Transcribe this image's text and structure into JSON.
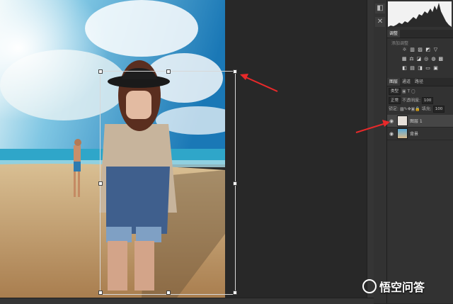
{
  "panels": {
    "adjustments": {
      "tab": "调整",
      "hint": "添加调整",
      "icons": [
        [
          "brightness-icon",
          "levels-icon",
          "curves-icon",
          "exposure-icon",
          "vibrance-icon"
        ],
        [
          "hsl-icon",
          "color-balance-icon",
          "bw-icon",
          "photo-filter-icon",
          "channel-mixer-icon",
          "lookup-icon"
        ],
        [
          "invert-icon",
          "posterize-icon",
          "threshold-icon",
          "gradient-map-icon",
          "selective-color-icon"
        ]
      ]
    },
    "layers": {
      "tabs": [
        "图层",
        "通道",
        "路径"
      ],
      "filter_label": "类型",
      "blend_mode": "正常",
      "opacity_label": "不透明度:",
      "opacity_value": "100",
      "lock_label": "锁定:",
      "fill_label": "填充:",
      "fill_value": "100",
      "items": [
        {
          "name": "图层 1",
          "selected": true
        },
        {
          "name": "背景",
          "selected": false
        }
      ]
    }
  },
  "toolstrip": [
    "panel-arrange-icon",
    "close-icon"
  ],
  "watermark": {
    "text": "悟空问答"
  },
  "colors": {
    "accent": "#e8292a",
    "canvas_bg": "#282828",
    "panel_bg": "#323232"
  }
}
